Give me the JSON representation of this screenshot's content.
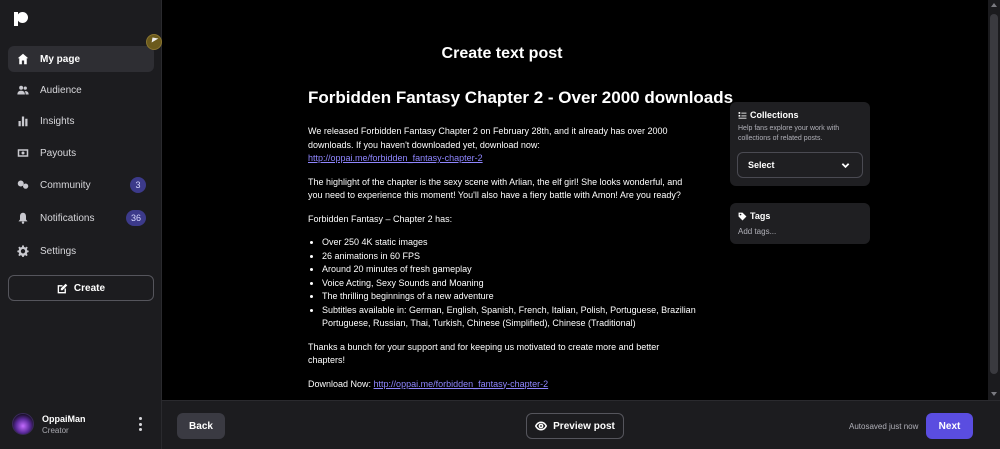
{
  "sidebar": {
    "items": [
      {
        "label": "My page",
        "icon": "home-icon",
        "active": true
      },
      {
        "label": "Audience",
        "icon": "people-icon"
      },
      {
        "label": "Insights",
        "icon": "bar-chart-icon"
      },
      {
        "label": "Payouts",
        "icon": "payout-icon"
      },
      {
        "label": "Community",
        "icon": "community-icon",
        "badge": "3"
      },
      {
        "label": "Notifications",
        "icon": "bell-icon",
        "badge": "36"
      },
      {
        "label": "Settings",
        "icon": "gear-icon"
      }
    ],
    "create_label": "Create",
    "user": {
      "name": "OppaiMan",
      "role": "Creator"
    }
  },
  "main": {
    "page_title": "Create text post",
    "post": {
      "title": "Forbidden Fantasy Chapter 2 - Over 2000 downloads",
      "p1": "We released Forbidden Fantasy Chapter 2 on February 28th, and it already has over 2000 downloads. If you haven't downloaded yet, download now:",
      "link": "http://oppai.me/forbidden_fantasy-chapter-2",
      "p2": "The highlight of the chapter is the sexy scene with Arlian, the elf girl! She looks wonderful, and you need to experience this moment! You'll also have a fiery battle with Amon! Are you ready?",
      "p3": "Forbidden Fantasy – Chapter 2 has:",
      "list": [
        "Over 250 4K static images",
        "26 animations in 60 FPS",
        "Around 20 minutes of fresh gameplay",
        "Voice Acting, Sexy Sounds and Moaning",
        "The thrilling beginnings of a new adventure",
        "Subtitles available in: German, English, Spanish, French, Italian, Polish, Portuguese, Brazilian Portuguese, Russian, Thai, Turkish, Chinese (Simplified), Chinese (Traditional)"
      ],
      "p4": "Thanks a bunch for your support and for keeping us motivated to create more and better chapters!",
      "download_label": "Download Now:",
      "download_link": "http://oppai.me/forbidden_fantasy-chapter-2"
    },
    "collections": {
      "title": "Collections",
      "description": "Help fans explore your work with collections of related posts.",
      "select_label": "Select"
    },
    "tags": {
      "title": "Tags",
      "placeholder": "Add tags..."
    }
  },
  "footer": {
    "back_label": "Back",
    "preview_label": "Preview post",
    "autosave_text": "Autosaved just now",
    "next_label": "Next"
  },
  "colors": {
    "accent": "#5a4de0",
    "link": "#8f86ff",
    "badge": "#3c3a8a"
  }
}
